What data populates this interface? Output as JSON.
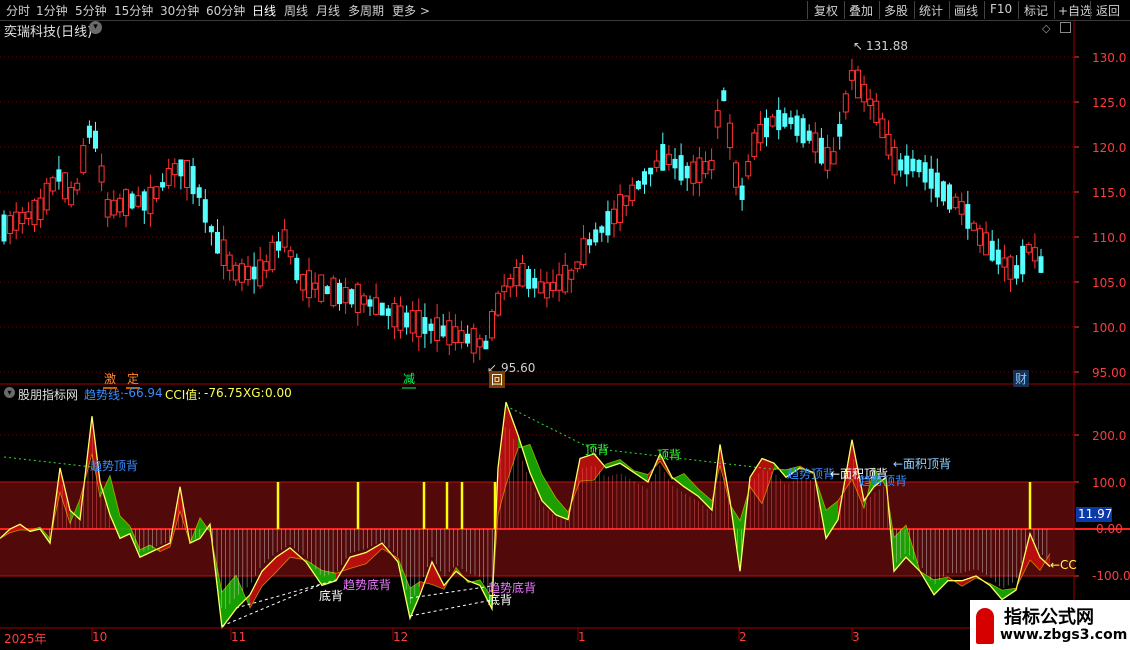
{
  "toolbar": {
    "periods": [
      "分时",
      "1分钟",
      "5分钟",
      "15分钟",
      "30分钟",
      "60分钟",
      "日线",
      "周线",
      "月线",
      "多周期",
      "更多 >"
    ],
    "active_period": "日线",
    "right_buttons": [
      "复权",
      "叠加",
      "多股",
      "统计",
      "画线",
      "F10",
      "标记",
      "+自选",
      "返回"
    ]
  },
  "main_panel": {
    "title": "奕瑞科技(日线)",
    "price_axis": [
      "130.0",
      "125.0",
      "120.0",
      "115.0",
      "110.0",
      "105.0",
      "100.0",
      "95.00"
    ],
    "high_marker": "131.88",
    "low_marker": "95.60",
    "event_tags": [
      "激",
      "定",
      "减",
      "回",
      "财"
    ]
  },
  "indicator_panel": {
    "title": "股朋指标网",
    "trend_label": "趋势线:",
    "trend_value": "-66.94",
    "cci_label": "CCI值:",
    "cci_value": "-76.75",
    "xg_label": "XG:",
    "xg_value": "0.00",
    "axis": [
      "200.0",
      "100.0",
      "0.00",
      "-100.0"
    ],
    "current_value": "11.97",
    "annotations": {
      "trend_top_1": "趋势顶背",
      "top_1": "顶背",
      "top_2": "顶背",
      "trend_top_2": "趋势顶背",
      "area_top_1": "←面积顶背",
      "trend_top_3": "趋势顶背",
      "area_top_2": "←面积顶背",
      "trend_bottom_1": "趋势底背",
      "bottom_1": "底背",
      "trend_bottom_2": "趋势底背",
      "bottom_2": "底背",
      "cci_edge": "←CC"
    }
  },
  "date_axis": [
    "2025年",
    "10",
    "11",
    "12",
    "1",
    "2",
    "3"
  ],
  "watermark": {
    "line1": "指标公式网",
    "line2": "www.zbgs3.com"
  },
  "colors": {
    "up": "#ff3232",
    "down": "#54ffff",
    "grid": "#7a0000",
    "axis_text": "#ff3c3c",
    "band": "#5a0a0a"
  }
}
